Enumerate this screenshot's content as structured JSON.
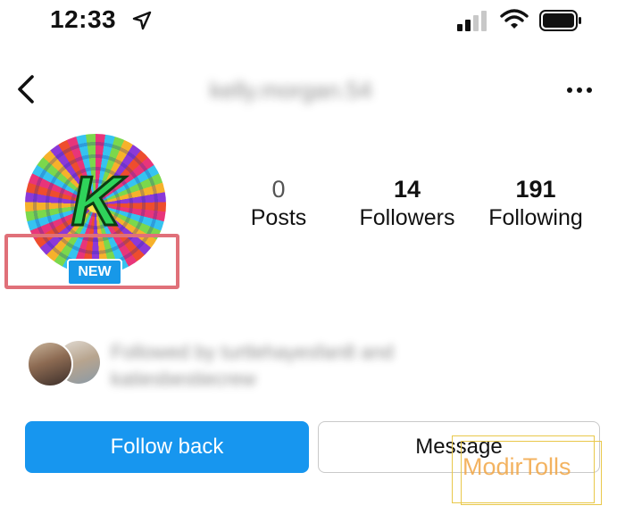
{
  "status_bar": {
    "time": "12:33",
    "icons": [
      "location-arrow-icon",
      "cellular-signal-icon",
      "wifi-icon",
      "battery-icon"
    ]
  },
  "header": {
    "username": "kelly.morgan.54",
    "back_icon": "chevron-left-icon",
    "more_icon": "more-options-icon"
  },
  "profile": {
    "avatar_letter": "K",
    "badge": "NEW",
    "stats": [
      {
        "value": "0",
        "label": "Posts"
      },
      {
        "value": "14",
        "label": "Followers"
      },
      {
        "value": "191",
        "label": "Following"
      }
    ],
    "followed_by": "Followed by turtlehayesfan8 and katiesbestiecrew"
  },
  "actions": {
    "follow_back": "Follow back",
    "message": "Message"
  },
  "watermark": "ModirTolls",
  "colors": {
    "primary_button": "#1796ef",
    "badge": "#1798e8",
    "highlight": "#e07079",
    "watermark": "#f2a645"
  }
}
